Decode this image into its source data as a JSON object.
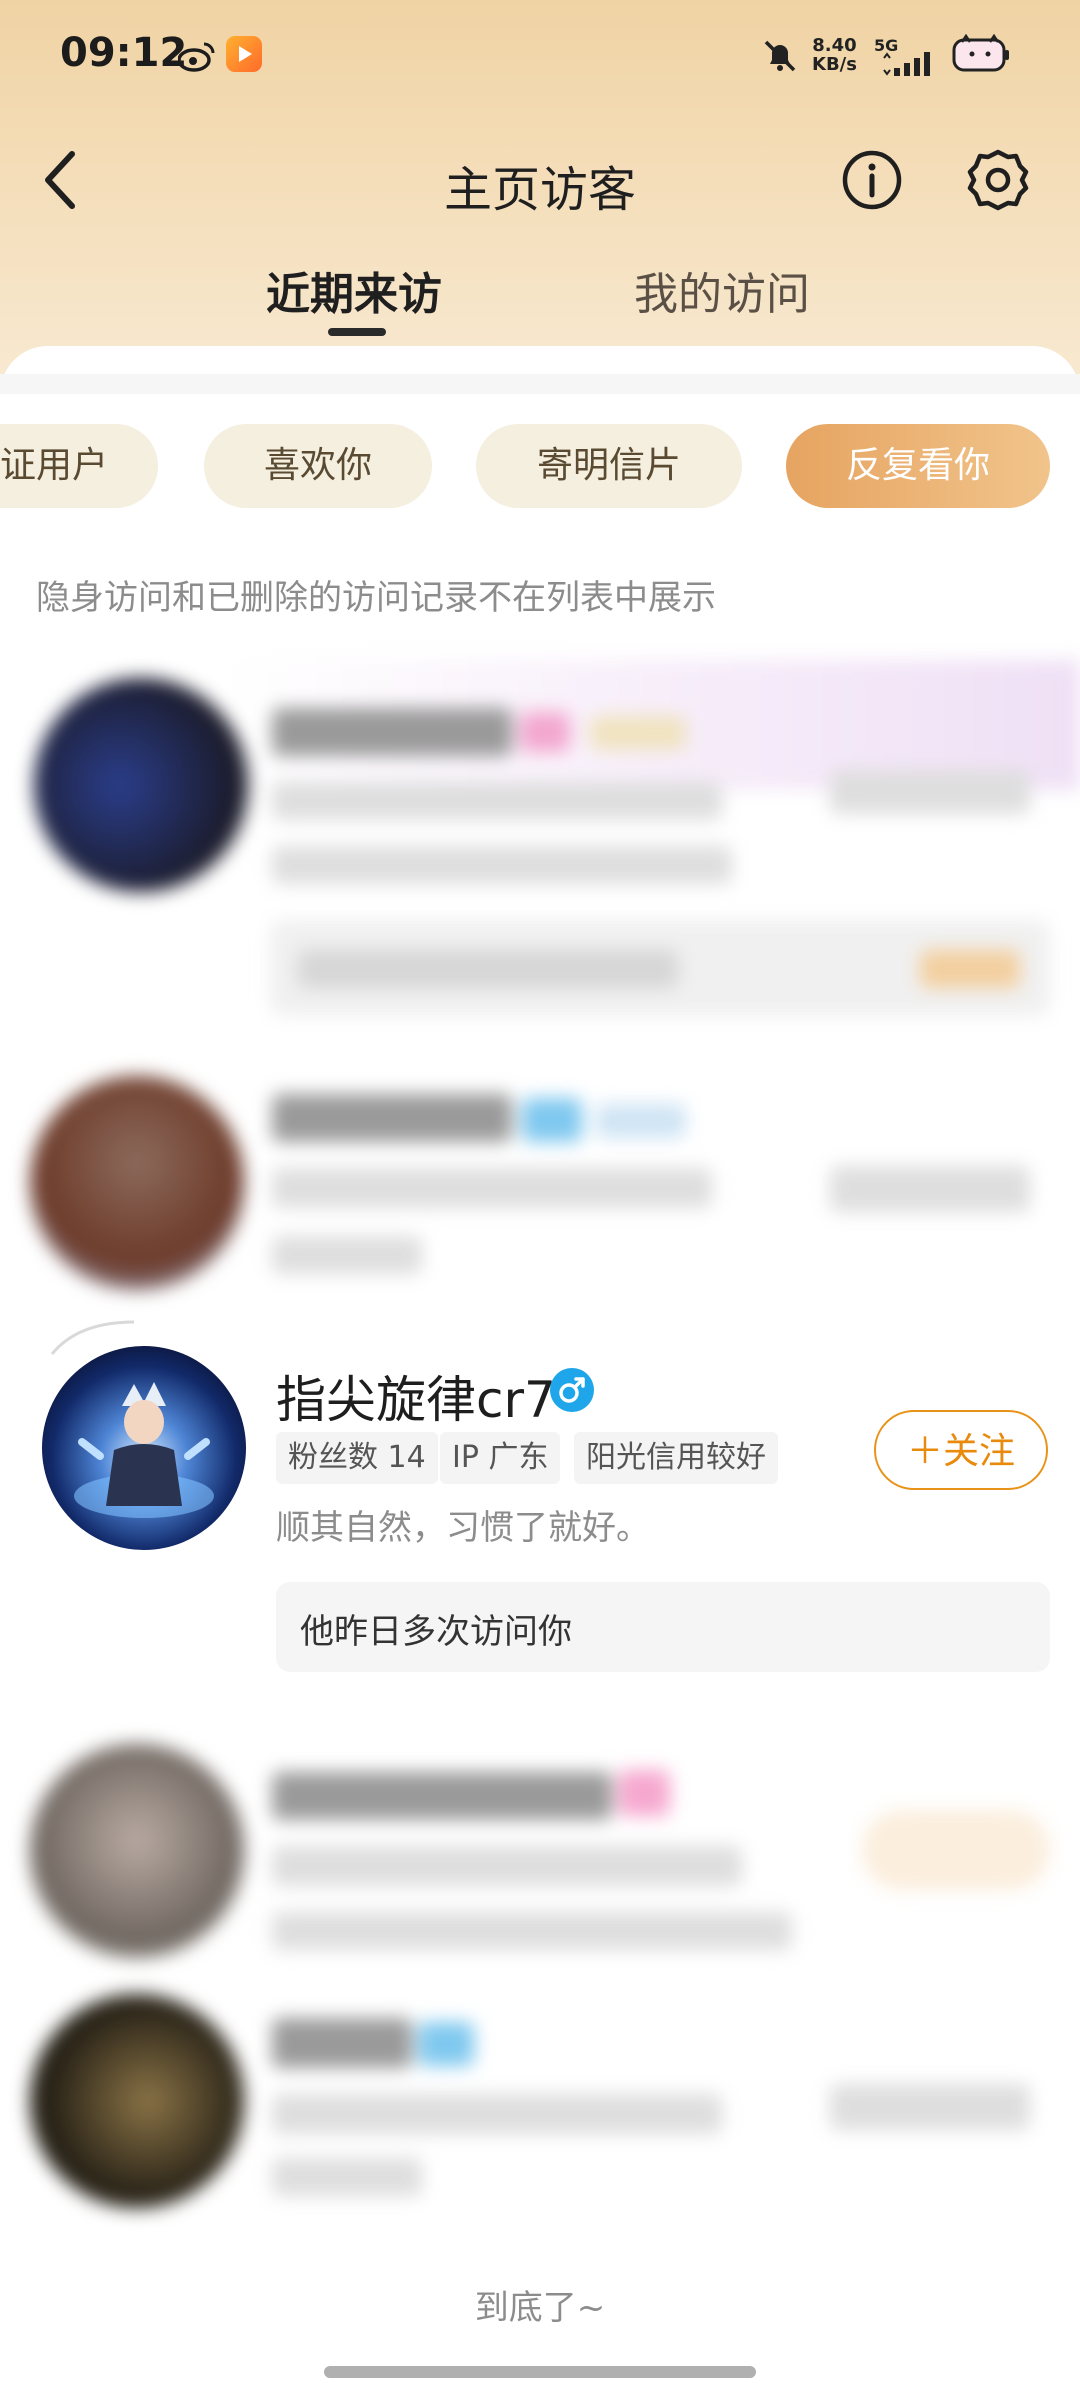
{
  "status_bar": {
    "time": "09:12",
    "net_speed_value": "8.40",
    "net_speed_unit": "KB/s",
    "signal_label": "5G"
  },
  "header": {
    "title": "主页访客",
    "back_icon": "back-arrow-icon",
    "info_icon": "info-icon",
    "settings_icon": "gear-icon"
  },
  "tabs": [
    {
      "label": "近期来访",
      "active": true
    },
    {
      "label": "我的访问",
      "active": false
    }
  ],
  "filters": [
    {
      "label": "证用户",
      "active": false
    },
    {
      "label": "喜欢你",
      "active": false
    },
    {
      "label": "寄明信片",
      "active": false
    },
    {
      "label": "反复看你",
      "active": true
    }
  ],
  "notice": "隐身访问和已删除的访问记录不在列表中展示",
  "featured_visitor": {
    "name": "指尖旋律cr7",
    "gender_symbol": "♂",
    "tags": [
      "粉丝数 14",
      "IP 广东",
      "阳光信用较好"
    ],
    "bio": "顺其自然，习惯了就好。",
    "follow_label": "＋关注",
    "visit_note": "他昨日多次访问你"
  },
  "footer": {
    "end_text": "到底了~"
  },
  "colors": {
    "accent": "#e88a0c",
    "header_gradient_top": "#f0d3a4",
    "active_chip_start": "#e6a461",
    "active_chip_end": "#f1c48b",
    "gender_blue": "#1fa6ea"
  }
}
